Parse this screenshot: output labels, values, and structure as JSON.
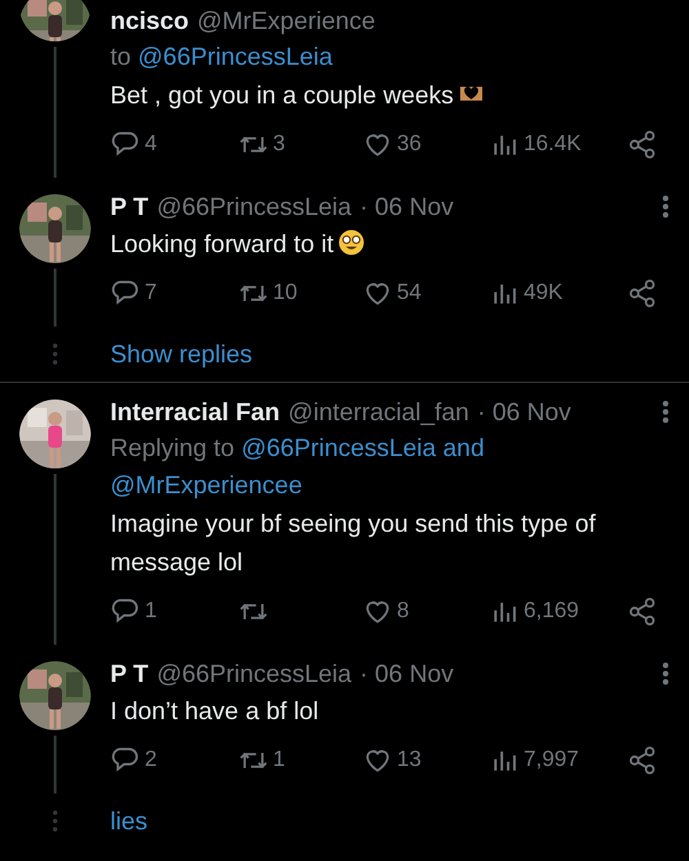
{
  "sections": [
    {
      "tweets": [
        {
          "name": "ncisco",
          "handle": "@MrExperience",
          "reply_prefix": "to",
          "reply_to": [
            "@66PrincessLeia"
          ],
          "text": "Bet , got you in a couple weeks",
          "emoji": {
            "kind": "heart-hands"
          },
          "stats": {
            "replies": "4",
            "reposts": "3",
            "likes": "36",
            "views": "16.4K"
          }
        },
        {
          "name": "P T",
          "handle": "@66PrincessLeia",
          "date": "· 06 Nov",
          "text": "Looking forward to it",
          "emoji": {
            "kind": "nerd-face"
          },
          "menu": true,
          "stats": {
            "replies": "7",
            "reposts": "10",
            "likes": "54",
            "views": "49K"
          }
        }
      ],
      "show_replies": "Show replies"
    },
    {
      "tweets": [
        {
          "name": "Interracial Fan",
          "handle": "@interracial_fan",
          "date": "· 06 Nov",
          "reply_prefix": "Replying to",
          "reply_to": [
            "@66PrincessLeia and",
            "@MrExperiencee"
          ],
          "text": "Imagine your bf seeing you send this type of message lol",
          "menu": true,
          "stats": {
            "replies": "1",
            "likes": "8",
            "views": "6,169"
          }
        },
        {
          "name": "P T",
          "handle": "@66PrincessLeia",
          "date": "· 06 Nov",
          "text": "I don’t have a bf lol",
          "menu": true,
          "stats": {
            "replies": "2",
            "reposts": "1",
            "likes": "13",
            "views": "7,997"
          }
        }
      ],
      "show_replies": "lies"
    }
  ]
}
